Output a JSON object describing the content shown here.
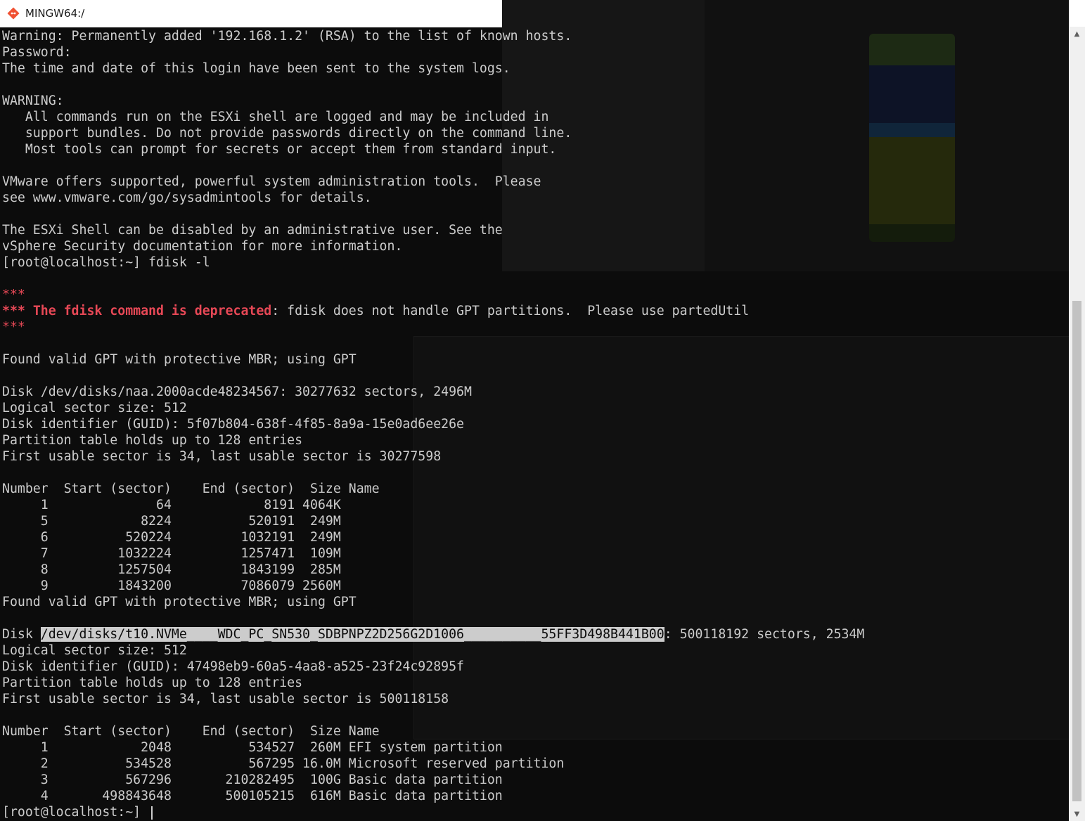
{
  "window": {
    "title": "MINGW64:/",
    "buttons": {
      "minimize": "—",
      "maximize": "☐",
      "close": "✕"
    }
  },
  "terminal": {
    "lines": [
      "Warning: Permanently added '192.168.1.2' (RSA) to the list of known hosts.",
      "Password:",
      "The time and date of this login have been sent to the system logs.",
      "",
      "WARNING:",
      "   All commands run on the ESXi shell are logged and may be included in",
      "   support bundles. Do not provide passwords directly on the command line.",
      "   Most tools can prompt for secrets or accept them from standard input.",
      "",
      "VMware offers supported, powerful system administration tools.  Please",
      "see www.vmware.com/go/sysadmintools for details.",
      "",
      "The ESXi Shell can be disabled by an administrative user. See the",
      "vSphere Security documentation for more information.",
      "[root@localhost:~] fdisk -l",
      "",
      "***",
      "",
      "***",
      "",
      "Found valid GPT with protective MBR; using GPT",
      "",
      "Disk /dev/disks/naa.2000acde48234567: 30277632 sectors, 2496M",
      "Logical sector size: 512",
      "Disk identifier (GUID): 5f07b804-638f-4f85-8a9a-15e0ad6ee26e",
      "Partition table holds up to 128 entries",
      "First usable sector is 34, last usable sector is 30277598",
      "",
      "Number  Start (sector)    End (sector)  Size Name",
      "     1              64            8191 4064K",
      "     5            8224          520191  249M",
      "     6          520224         1032191  249M",
      "     7         1032224         1257471  109M",
      "     8         1257504         1843199  285M",
      "     9         1843200         7086079 2560M",
      "Found valid GPT with protective MBR; using GPT",
      "",
      "",
      "Logical sector size: 512",
      "Disk identifier (GUID): 47498eb9-60a5-4aa8-a525-23f24c92895f",
      "Partition table holds up to 128 entries",
      "First usable sector is 34, last usable sector is 500118158",
      "",
      "Number  Start (sector)    End (sector)  Size Name",
      "     1            2048          534527  260M EFI system partition",
      "     2          534528          567295 16.0M Microsoft reserved partition",
      "     3          567296       210282495  100G Basic data partition",
      "     4       498843648       500105215  616M Basic data partition",
      ""
    ],
    "deprecation": {
      "prefix": "*** ",
      "highlight": "The fdisk command is deprecated",
      "rest": ": fdisk does not handle GPT partitions.  Please use partedUtil"
    },
    "disk2": {
      "prefix": "Disk ",
      "selected_path": "/dev/disks/t10.NVMe____WDC_PC_SN530_SDBPNPZ2D256G2D1006__________55FF3D498B441B00",
      "suffix": ": 500118192 sectors, 2534M"
    },
    "prompt": "[root@localhost:~] "
  },
  "colors": {
    "background": "#0c0c0c",
    "foreground": "#cccccc",
    "error_red": "#e74856",
    "selection_bg": "#cccccc"
  },
  "icons": {
    "app": "git-bash-icon",
    "scroll_up": "arrow-up-icon",
    "scroll_down": "arrow-down-icon"
  }
}
